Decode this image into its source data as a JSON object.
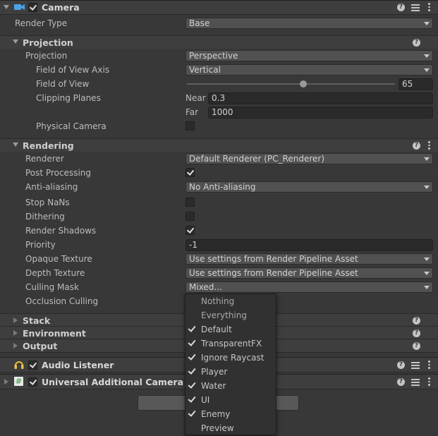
{
  "camera": {
    "title": "Camera",
    "render_type": {
      "label": "Render Type",
      "value": "Base"
    },
    "projection": {
      "header": "Projection",
      "projection": {
        "label": "Projection",
        "value": "Perspective"
      },
      "fov_axis": {
        "label": "Field of View Axis",
        "value": "Vertical"
      },
      "fov": {
        "label": "Field of View",
        "value": "65",
        "slider_fraction": 0.56
      },
      "clipping": {
        "label": "Clipping Planes",
        "near_label": "Near",
        "near": "0.3",
        "far_label": "Far",
        "far": "1000"
      },
      "physical": {
        "label": "Physical Camera",
        "checked": false
      }
    },
    "rendering": {
      "header": "Rendering",
      "renderer": {
        "label": "Renderer",
        "value": "Default Renderer (PC_Renderer)"
      },
      "post_processing": {
        "label": "Post Processing",
        "checked": true
      },
      "anti_aliasing": {
        "label": "Anti-aliasing",
        "value": "No Anti-aliasing"
      },
      "stop_nans": {
        "label": "Stop NaNs",
        "checked": false
      },
      "dithering": {
        "label": "Dithering",
        "checked": false
      },
      "render_shadows": {
        "label": "Render Shadows",
        "checked": true
      },
      "priority": {
        "label": "Priority",
        "value": "-1"
      },
      "opaque_texture": {
        "label": "Opaque Texture",
        "value": "Use settings from Render Pipeline Asset"
      },
      "depth_texture": {
        "label": "Depth Texture",
        "value": "Use settings from Render Pipeline Asset"
      },
      "culling_mask": {
        "label": "Culling Mask",
        "value": "Mixed..."
      },
      "occlusion_culling": {
        "label": "Occlusion Culling"
      }
    },
    "stack": {
      "header": "Stack"
    },
    "environment": {
      "header": "Environment"
    },
    "output": {
      "header": "Output"
    }
  },
  "audio_listener": {
    "title": "Audio Listener"
  },
  "universal_camera": {
    "title": "Universal Additional Camera Da"
  },
  "culling_popup": {
    "items": [
      {
        "label": "Nothing",
        "checked": false
      },
      {
        "label": "Everything",
        "checked": false
      },
      {
        "label": "Default",
        "checked": true
      },
      {
        "label": "TransparentFX",
        "checked": true
      },
      {
        "label": "Ignore Raycast",
        "checked": true
      },
      {
        "label": "Player",
        "checked": true
      },
      {
        "label": "Water",
        "checked": true
      },
      {
        "label": "UI",
        "checked": true
      },
      {
        "label": "Enemy",
        "checked": true
      },
      {
        "label": "Preview",
        "checked": false
      }
    ]
  },
  "icons": {
    "help": "help-icon",
    "settings": "preset-settings-icon",
    "more": "more-options-icon",
    "camera": "camera-icon",
    "audio": "headphones-icon",
    "script": "script-icon"
  },
  "colors": {
    "accent_camera": "#4aa3e8",
    "audio_yellow": "#e8c23a",
    "script_green": "#58a55c"
  }
}
